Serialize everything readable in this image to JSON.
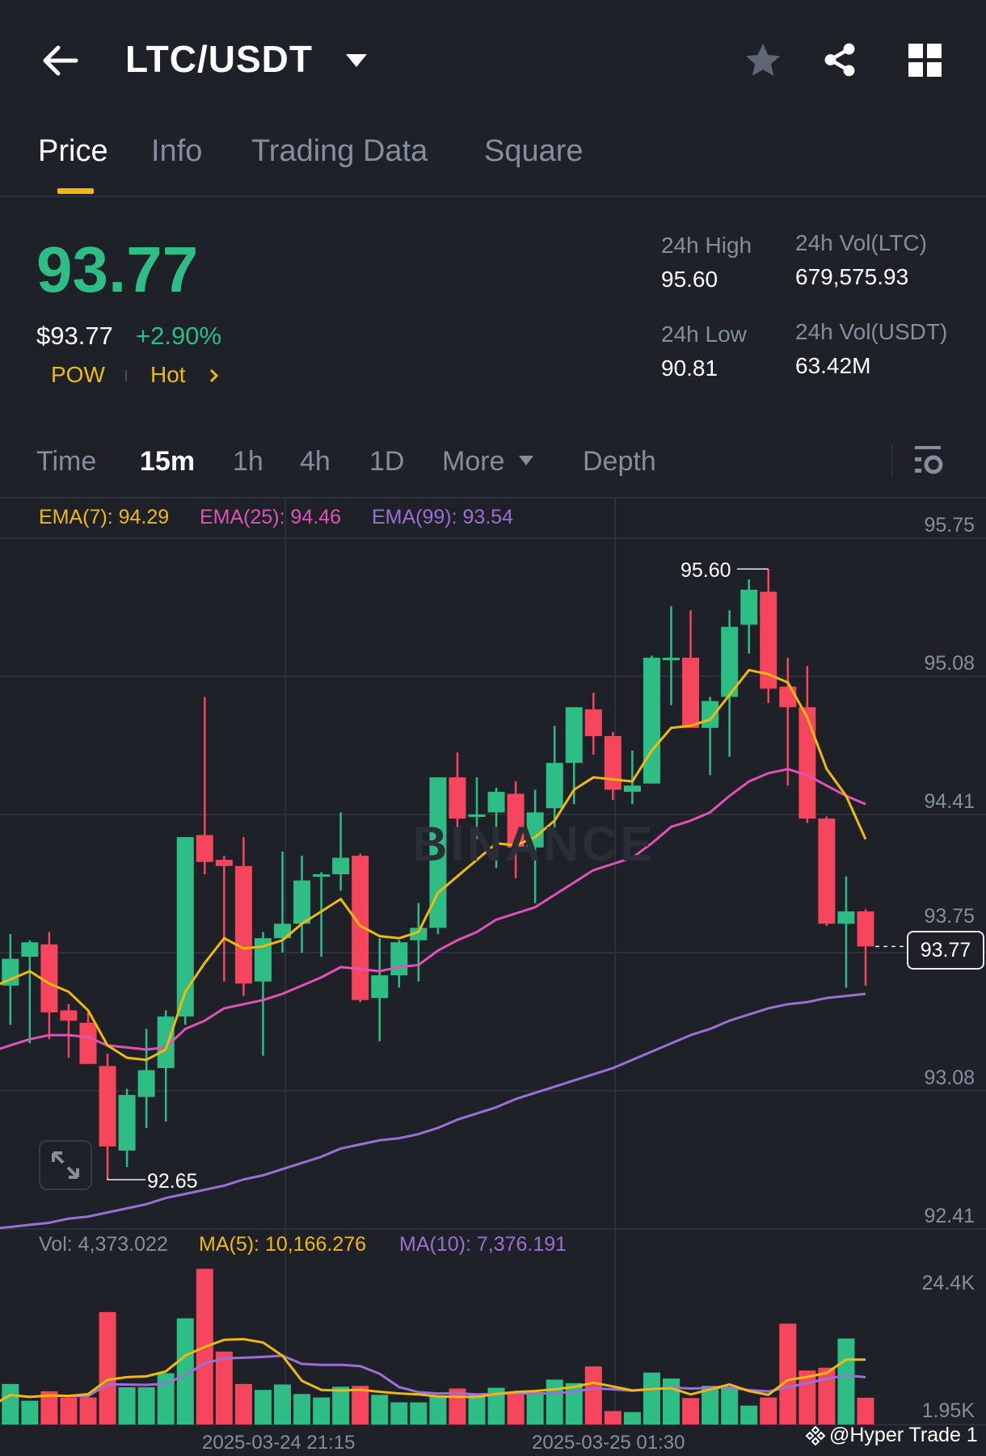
{
  "header": {
    "title": "LTC/USDT",
    "icons": [
      "back-arrow-icon",
      "caret-down-icon",
      "star-icon",
      "share-icon",
      "grid-icon"
    ]
  },
  "tabs": [
    {
      "label": "Price",
      "active": true
    },
    {
      "label": "Info"
    },
    {
      "label": "Trading Data"
    },
    {
      "label": "Square"
    }
  ],
  "ticker": {
    "last_price": "93.77",
    "usd_price": "$93.77",
    "change": "+2.90%",
    "tags": [
      "POW",
      "Hot"
    ],
    "stats": {
      "high_label": "24h High",
      "high": "95.60",
      "low_label": "24h Low",
      "low": "90.81",
      "vol_ltc_label": "24h Vol(LTC)",
      "vol_ltc": "679,575.93",
      "vol_usdt_label": "24h Vol(USDT)",
      "vol_usdt": "63.42M"
    }
  },
  "intervals": [
    {
      "label": "Time"
    },
    {
      "label": "15m",
      "active": true
    },
    {
      "label": "1h"
    },
    {
      "label": "4h"
    },
    {
      "label": "1D"
    },
    {
      "label": "More"
    },
    {
      "label": "Depth"
    }
  ],
  "legend": {
    "ema7": "EMA(7): 94.29",
    "ema25": "EMA(25): 94.46",
    "ema99": "EMA(99): 93.54"
  },
  "vol_legend": {
    "vol": "Vol: 4,373.022",
    "ma5": "MA(5): 10,166.276",
    "ma10": "MA(10): 7,376.191"
  },
  "price_axis": [
    "95.75",
    "95.08",
    "94.41",
    "93.75",
    "93.08",
    "92.41"
  ],
  "vol_axis": [
    "24.4K",
    "1.95K"
  ],
  "dates": [
    "2025-03-24 21:15",
    "2025-03-25 01:30"
  ],
  "current_price_tag": "93.77",
  "high_marker": "95.60",
  "low_marker": "92.65",
  "watermark": "BINANCE",
  "credit": "@Hyper Trade 1",
  "colors": {
    "up": "#2ebd85",
    "down": "#f6465d",
    "ema7": "#f0b90b",
    "ema25": "#e052b8",
    "ema99": "#9b6fd6",
    "accent": "#f0b90b"
  },
  "chart_data": {
    "type": "candlestick",
    "interval": "15m",
    "ylim": [
      92.41,
      95.75
    ],
    "candles": [
      [
        93.37,
        93.6,
        93.35,
        93.57
      ],
      [
        93.58,
        93.83,
        93.39,
        93.71
      ],
      [
        93.72,
        93.8,
        93.3,
        93.79
      ],
      [
        93.78,
        93.84,
        93.32,
        93.45
      ],
      [
        93.46,
        93.49,
        93.23,
        93.41
      ],
      [
        93.4,
        93.45,
        93.2,
        93.2
      ],
      [
        93.19,
        93.25,
        92.65,
        92.8
      ],
      [
        92.78,
        93.08,
        92.7,
        93.05
      ],
      [
        93.04,
        93.37,
        92.89,
        93.17
      ],
      [
        93.18,
        93.46,
        92.92,
        93.43
      ],
      [
        93.43,
        94.3,
        93.39,
        94.3
      ],
      [
        94.31,
        94.98,
        94.12,
        94.18
      ],
      [
        94.19,
        94.21,
        93.6,
        94.16
      ],
      [
        94.16,
        94.3,
        93.53,
        93.59
      ],
      [
        93.6,
        93.84,
        93.24,
        93.81
      ],
      [
        93.81,
        94.23,
        93.74,
        93.88
      ],
      [
        93.88,
        94.21,
        93.74,
        94.09
      ],
      [
        94.11,
        94.13,
        93.72,
        94.12
      ],
      [
        94.12,
        94.42,
        94.04,
        94.2
      ],
      [
        94.21,
        94.22,
        93.5,
        93.51
      ],
      [
        93.52,
        93.81,
        93.31,
        93.63
      ],
      [
        93.63,
        93.8,
        93.57,
        93.79
      ],
      [
        93.8,
        93.98,
        93.6,
        93.86
      ],
      [
        93.86,
        94.59,
        93.83,
        94.59
      ],
      [
        94.59,
        94.71,
        94.33,
        94.39
      ],
      [
        94.4,
        94.59,
        94.29,
        94.41
      ],
      [
        94.42,
        94.54,
        94.15,
        94.52
      ],
      [
        94.51,
        94.57,
        94.1,
        94.25
      ],
      [
        94.25,
        94.53,
        93.98,
        94.42
      ],
      [
        94.44,
        94.84,
        94.3,
        94.66
      ],
      [
        94.66,
        94.93,
        94.46,
        94.93
      ],
      [
        94.92,
        95.0,
        94.7,
        94.79
      ],
      [
        94.79,
        94.81,
        94.48,
        94.53
      ],
      [
        94.52,
        94.72,
        94.46,
        94.55
      ],
      [
        94.56,
        95.18,
        94.56,
        95.17
      ],
      [
        95.16,
        95.42,
        94.94,
        95.17
      ],
      [
        95.17,
        95.4,
        94.83,
        94.83
      ],
      [
        94.83,
        94.98,
        94.6,
        94.96
      ],
      [
        94.98,
        95.4,
        94.69,
        95.32
      ],
      [
        95.33,
        95.55,
        95.19,
        95.5
      ],
      [
        95.49,
        95.6,
        94.95,
        95.02
      ],
      [
        95.03,
        95.17,
        94.55,
        94.93
      ],
      [
        94.93,
        95.13,
        94.37,
        94.39
      ],
      [
        94.39,
        94.4,
        93.87,
        93.88
      ],
      [
        93.88,
        94.11,
        93.57,
        93.94
      ],
      [
        93.94,
        93.95,
        93.58,
        93.77
      ]
    ],
    "ema7": [
      93.57,
      93.61,
      93.65,
      93.59,
      93.55,
      93.46,
      93.29,
      93.23,
      93.22,
      93.27,
      93.55,
      93.69,
      93.81,
      93.76,
      93.77,
      93.8,
      93.88,
      93.94,
      94.0,
      93.87,
      93.82,
      93.81,
      93.84,
      94.03,
      94.11,
      94.19,
      94.27,
      94.26,
      94.3,
      94.38,
      94.53,
      94.59,
      94.58,
      94.57,
      94.72,
      94.83,
      94.84,
      94.87,
      94.99,
      95.11,
      95.09,
      95.05,
      94.88,
      94.63,
      94.5,
      94.29
    ],
    "ema25": [
      93.26,
      93.29,
      93.32,
      93.34,
      93.34,
      93.33,
      93.29,
      93.28,
      93.27,
      93.28,
      93.37,
      93.41,
      93.47,
      93.49,
      93.51,
      93.54,
      93.58,
      93.62,
      93.67,
      93.66,
      93.65,
      93.67,
      93.68,
      93.75,
      93.8,
      93.84,
      93.9,
      93.93,
      93.96,
      94.02,
      94.08,
      94.14,
      94.17,
      94.2,
      94.27,
      94.35,
      94.38,
      94.42,
      94.5,
      94.57,
      94.61,
      94.63,
      94.6,
      94.55,
      94.5,
      94.46
    ],
    "ema99": [
      92.4,
      92.41,
      92.42,
      92.43,
      92.45,
      92.46,
      92.48,
      92.5,
      92.52,
      92.55,
      92.57,
      92.59,
      92.61,
      92.64,
      92.66,
      92.69,
      92.72,
      92.75,
      92.79,
      92.81,
      92.83,
      92.84,
      92.86,
      92.89,
      92.93,
      92.96,
      92.99,
      93.03,
      93.06,
      93.09,
      93.12,
      93.15,
      93.18,
      93.22,
      93.26,
      93.3,
      93.34,
      93.37,
      93.41,
      93.44,
      93.47,
      93.49,
      93.5,
      93.52,
      93.53,
      93.54
    ],
    "volume_k": [
      2.9,
      6.77,
      3.84,
      5.49,
      4.41,
      4.41,
      19.34,
      6.2,
      6.2,
      8.66,
      18.25,
      26.9,
      12.44,
      6.77,
      5.73,
      6.68,
      5.02,
      4.41,
      6.3,
      6.44,
      4.88,
      3.56,
      3.56,
      4.55,
      5.97,
      4.88,
      6.11,
      5.35,
      5.35,
      7.53,
      6.91,
      9.84,
      2.04,
      1.86,
      8.76,
      7.72,
      4.31,
      6.44,
      6.2,
      2.99,
      4.41,
      17.31,
      9.13,
      9.61,
      14.71,
      4.37
    ],
    "vol_ylim_labels": [
      1.95,
      24.4
    ]
  }
}
